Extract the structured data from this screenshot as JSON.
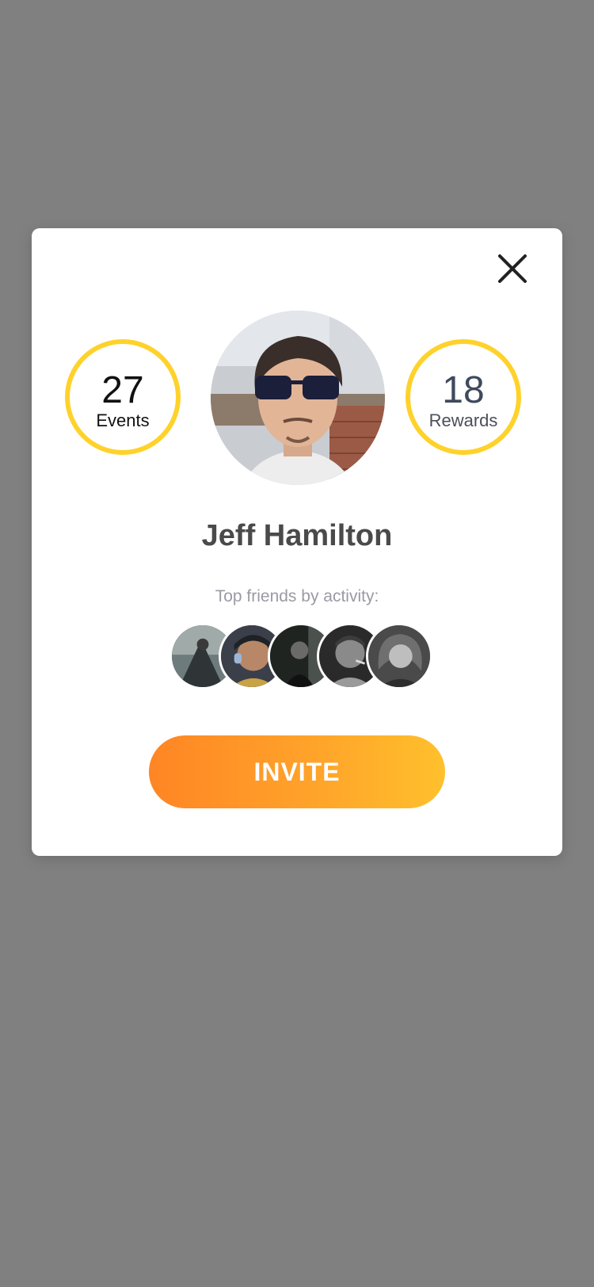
{
  "stats": {
    "events": {
      "value": "27",
      "label": "Events"
    },
    "rewards": {
      "value": "18",
      "label": "Rewards"
    }
  },
  "profile": {
    "name": "Jeff Hamilton"
  },
  "friends": {
    "label": "Top friends by activity:"
  },
  "actions": {
    "invite_label": "INVITE",
    "close_icon": "close-icon"
  },
  "colors": {
    "ring": "#FFD22B",
    "invite_gradient_start": "#FF8524",
    "invite_gradient_end": "#FFC02C",
    "overlay": "#808080"
  }
}
